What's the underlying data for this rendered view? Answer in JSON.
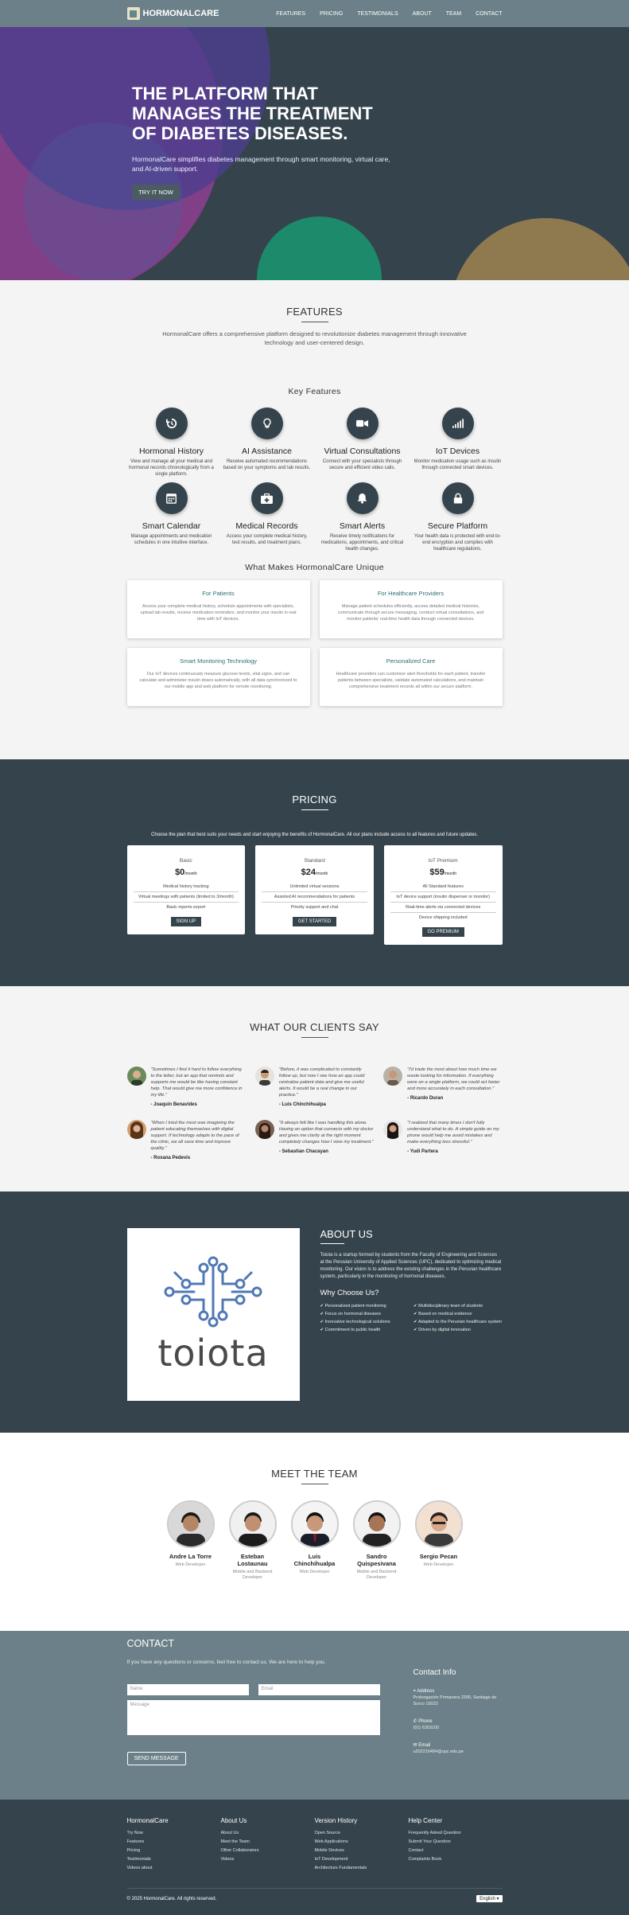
{
  "header": {
    "brand": "HORMONALCARE",
    "nav": [
      "FEATURES",
      "PRICING",
      "TESTIMONIALS",
      "ABOUT",
      "TEAM",
      "CONTACT"
    ]
  },
  "hero": {
    "title": "THE PLATFORM THAT MANAGES THE TREATMENT OF DIABETES DISEASES.",
    "subtitle": "HormonalCare simplifies diabetes management through smart monitoring, virtual care, and AI-driven support.",
    "cta": "TRY IT NOW"
  },
  "features": {
    "title": "FEATURES",
    "intro": "HormonalCare offers a comprehensive platform designed to revolutionize diabetes management through innovative technology and user-centered design.",
    "key_title": "Key Features",
    "items": [
      {
        "icon": "history-icon",
        "title": "Hormonal History",
        "desc": "View and manage all your medical and hormonal records chronologically from a single platform."
      },
      {
        "icon": "lightbulb-icon",
        "title": "AI Assistance",
        "desc": "Receive automated recommendations based on your symptoms and lab results."
      },
      {
        "icon": "video-camera-icon",
        "title": "Virtual Consultations",
        "desc": "Connect with your specialists through secure and efficient video calls."
      },
      {
        "icon": "signal-icon",
        "title": "IoT Devices",
        "desc": "Monitor medication usage such as insulin through connected smart devices."
      },
      {
        "icon": "calendar-icon",
        "title": "Smart Calendar",
        "desc": "Manage appointments and medication schedules in one intuitive interface."
      },
      {
        "icon": "medical-kit-icon",
        "title": "Medical Records",
        "desc": "Access your complete medical history, test results, and treatment plans."
      },
      {
        "icon": "bell-icon",
        "title": "Smart Alerts",
        "desc": "Receive timely notifications for medications, appointments, and critical health changes."
      },
      {
        "icon": "lock-icon",
        "title": "Secure Platform",
        "desc": "Your health data is protected with end-to-end encryption and complies with healthcare regulations."
      }
    ],
    "unique_title": "What Makes HormonalCare Unique",
    "unique": [
      {
        "title": "For Patients",
        "desc": "Access your complete medical history, schedule appointments with specialists, upload lab results, receive medication reminders, and monitor your insulin in real time with IoT devices."
      },
      {
        "title": "For Healthcare Providers",
        "desc": "Manage patient schedules efficiently, access detailed medical histories, communicate through secure messaging, conduct virtual consultations, and monitor patients' real-time health data through connected devices."
      },
      {
        "title": "Smart Monitoring Technology",
        "desc": "Our IoT devices continuously measure glucose levels, vital signs, and can calculate and administer insulin doses automatically, with all data synchronized to our mobile app and web platform for remote monitoring."
      },
      {
        "title": "Personalized Care",
        "desc": "Healthcare providers can customize alert thresholds for each patient, transfer patients between specialists, validate automated calculations, and maintain comprehensive treatment records all within our secure platform."
      }
    ]
  },
  "pricing": {
    "title": "PRICING",
    "intro": "Choose the plan that best suits your needs and start enjoying the benefits of HormonalCare. All our plans include access to all features and future updates.",
    "plans": [
      {
        "name": "Basic",
        "price": "$0",
        "period": "/month",
        "features": [
          "Medical history tracking",
          "Virtual meetings with patients (limited to 3/month)",
          "Basic reports export"
        ],
        "cta": "SIGN UP"
      },
      {
        "name": "Standard",
        "price": "$24",
        "period": "/month",
        "features": [
          "Unlimited virtual sessions",
          "Assisted AI recommendations for patients",
          "Priority support and chat"
        ],
        "cta": "GET STARTED"
      },
      {
        "name": "IoT Premium",
        "price": "$59",
        "period": "/month",
        "features": [
          "All Standard features",
          "IoT device support (insulin dispenser or monitor)",
          "Real-time alerts via connected devices",
          "Device shipping included"
        ],
        "cta": "GO PREMIUM"
      }
    ]
  },
  "testimonials": {
    "title": "WHAT OUR CLIENTS SAY",
    "items": [
      {
        "quote": "\"Sometimes I find it hard to follow everything to the letter, but an app that reminds and supports me would be like having constant help. That would give me more confidence in my life.\"",
        "name": "- Joaquin Benavides"
      },
      {
        "quote": "\"Before, it was complicated to constantly follow up, but now I see how an app could centralize patient data and give me useful alerts. It would be a real change in our practice.\"",
        "name": "- Luis Chinchihualpa"
      },
      {
        "quote": "\"I'd trade the most about how much time we waste looking for information. If everything were on a single platform, we could act faster and more accurately in each consultation.\"",
        "name": "- Ricardo Duran"
      },
      {
        "quote": "\"When I tried the most was imagining the patient educating themselves with digital support. If technology adapts to the pace of the clinic, we all save time and improve quality.\"",
        "name": "- Roxana Pedevis"
      },
      {
        "quote": "\"It always felt like I was handling this alone. Having an option that connects with my doctor and gives me clarity at the right moment completely changes how I view my treatment.\"",
        "name": "- Sebastian Chacayan"
      },
      {
        "quote": "\"I realized that many times I don't fully understand what to do. A simple guide on my phone would help me avoid mistakes and make everything less stressful.\"",
        "name": "- Yudi Partera"
      }
    ]
  },
  "about": {
    "logo_text": "toiota",
    "title": "ABOUT US",
    "body": "Toiota is a startup formed by students from the Faculty of Engineering and Sciences at the Peruvian University of Applied Sciences (UPC), dedicated to optimizing medical monitoring. Our vision is to address the existing challenges in the Peruvian healthcare system, particularly in the monitoring of hormonal diseases.",
    "why_title": "Why Choose Us?",
    "why": [
      "Personalized patient monitoring",
      "Multidisciplinary team of students",
      "Focus on hormonal diseases",
      "Based on medical evidence",
      "Innovative technological solutions",
      "Adapted to the Peruvian healthcare system",
      "Commitment to public health",
      "Driven by digital innovation"
    ]
  },
  "team": {
    "title": "MEET THE TEAM",
    "members": [
      {
        "name": "Andre La Torre",
        "role": "Web Developer"
      },
      {
        "name": "Esteban Lostaunau",
        "role": "Mobile and Backend Developer"
      },
      {
        "name": "Luis Chinchihualpa",
        "role": "Web Developer"
      },
      {
        "name": "Sandro Quispesivana",
        "role": "Mobile and Backend Developer"
      },
      {
        "name": "Sergio Pecan",
        "role": "Web Developer"
      }
    ]
  },
  "contact": {
    "title": "CONTACT",
    "intro": "If you have any questions or concerns, feel free to contact us. We are here to help you.",
    "name_placeholder": "Name",
    "email_placeholder": "Email",
    "message_placeholder": "Message",
    "send": "SEND MESSAGE",
    "info_title": "Contact Info",
    "address_label": "Address",
    "address": "Prolongación Primavera 2390, Santiago de Surco 15023",
    "phone_label": "Phone",
    "phone": "(01) 6303100",
    "email_label": "Email",
    "email": "u202216484@upc.edu.pe"
  },
  "footer": {
    "cols": [
      {
        "title": "HormonalCare",
        "links": [
          "Try Now",
          "Features",
          "Pricing",
          "Testimonials",
          "Videos about"
        ]
      },
      {
        "title": "About Us",
        "links": [
          "About Us",
          "Meet the Team",
          "Other Collaborators",
          "Videos"
        ]
      },
      {
        "title": "Version History",
        "links": [
          "Open Source",
          "Web Applications",
          "Mobile Devices",
          "IoT Development",
          "Architecture Fundamentals"
        ]
      },
      {
        "title": "Help Center",
        "links": [
          "Frequently Asked Question",
          "Submit Your Question",
          "Contact",
          "Complaints Book"
        ]
      }
    ],
    "copyright": "© 2025 HormonalCare. All rights reserved.",
    "language": "English"
  }
}
